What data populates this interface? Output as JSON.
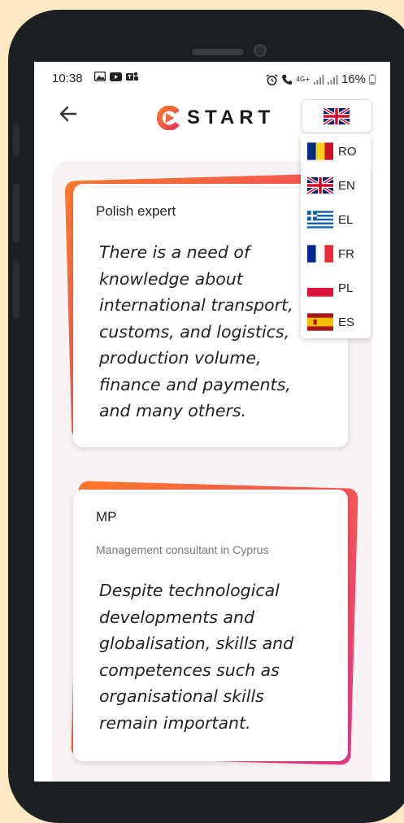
{
  "status_bar": {
    "time": "10:38",
    "left_icons": [
      "image-icon",
      "youtube-icon",
      "teams-icon"
    ],
    "right_icons": [
      "alarm-icon",
      "call-icon",
      "4g-icon",
      "signal-icon",
      "signal-icon"
    ],
    "network_label": "4G+",
    "battery_percent": "16%"
  },
  "app_bar": {
    "back_icon": "arrow-left-icon",
    "logo_text": "START",
    "selected_language_flag": "uk-flag-icon"
  },
  "language_menu": [
    {
      "code": "RO",
      "flag": "romania-flag-icon"
    },
    {
      "code": "EN",
      "flag": "uk-flag-icon"
    },
    {
      "code": "EL",
      "flag": "greece-flag-icon"
    },
    {
      "code": "FR",
      "flag": "france-flag-icon"
    },
    {
      "code": "PL",
      "flag": "poland-flag-icon"
    },
    {
      "code": "ES",
      "flag": "spain-flag-icon"
    }
  ],
  "testimonials": [
    {
      "name": "Polish expert",
      "role": "",
      "quote_lines": [
        "There is a need of",
        "knowledge about",
        "international transport,",
        "customs, and logistics,",
        "production volume,",
        "finance and payments,",
        "and many others."
      ]
    },
    {
      "name": "MP",
      "role": "Management consultant in Cyprus",
      "quote_lines": [
        "Despite technological",
        "developments and",
        "globalisation, skills and",
        "competences such as",
        "organisational skills",
        "remain important."
      ]
    }
  ],
  "colors": {
    "accent_orange": "#ff7a2a",
    "accent_pink": "#e83a8c",
    "background": "#fde9c4"
  }
}
